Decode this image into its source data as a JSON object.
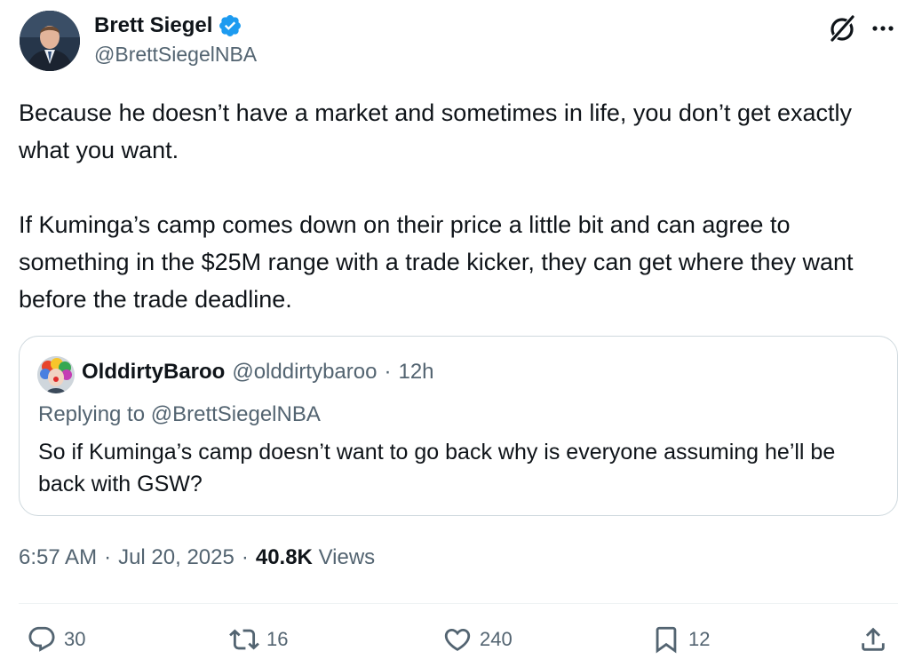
{
  "author": {
    "name": "Brett Siegel",
    "handle": "@BrettSiegelNBA",
    "verified": true
  },
  "tweet": {
    "paragraphs": [
      "Because he doesn’t have a market and sometimes in life, you don’t get exactly what you want.",
      "If Kuminga’s camp comes down on their price a little bit and can agree to something in the $25M range with a trade kicker, they can get where they want before the trade deadline."
    ]
  },
  "quote": {
    "name": "OlddirtyBaroo",
    "handle": "@olddirtybaroo",
    "separator": "·",
    "time": "12h",
    "replying_to": "Replying to @BrettSiegelNBA",
    "text": "So if Kuminga’s camp doesn’t want to go back why is everyone assuming he’ll be back with GSW?"
  },
  "meta": {
    "time": "6:57 AM",
    "separator": "·",
    "date": "Jul 20, 2025",
    "views_count": "40.8K",
    "views_label": "Views"
  },
  "actions": {
    "reply_count": "30",
    "retweet_count": "16",
    "like_count": "240",
    "bookmark_count": "12"
  },
  "colors": {
    "text": "#0f1419",
    "secondary": "#536471",
    "verified": "#1d9bf0",
    "border": "#cfd9de"
  },
  "icons": [
    "verified-badge-icon",
    "grok-icon",
    "more-icon",
    "reply-icon",
    "retweet-icon",
    "like-icon",
    "bookmark-icon",
    "share-icon"
  ]
}
